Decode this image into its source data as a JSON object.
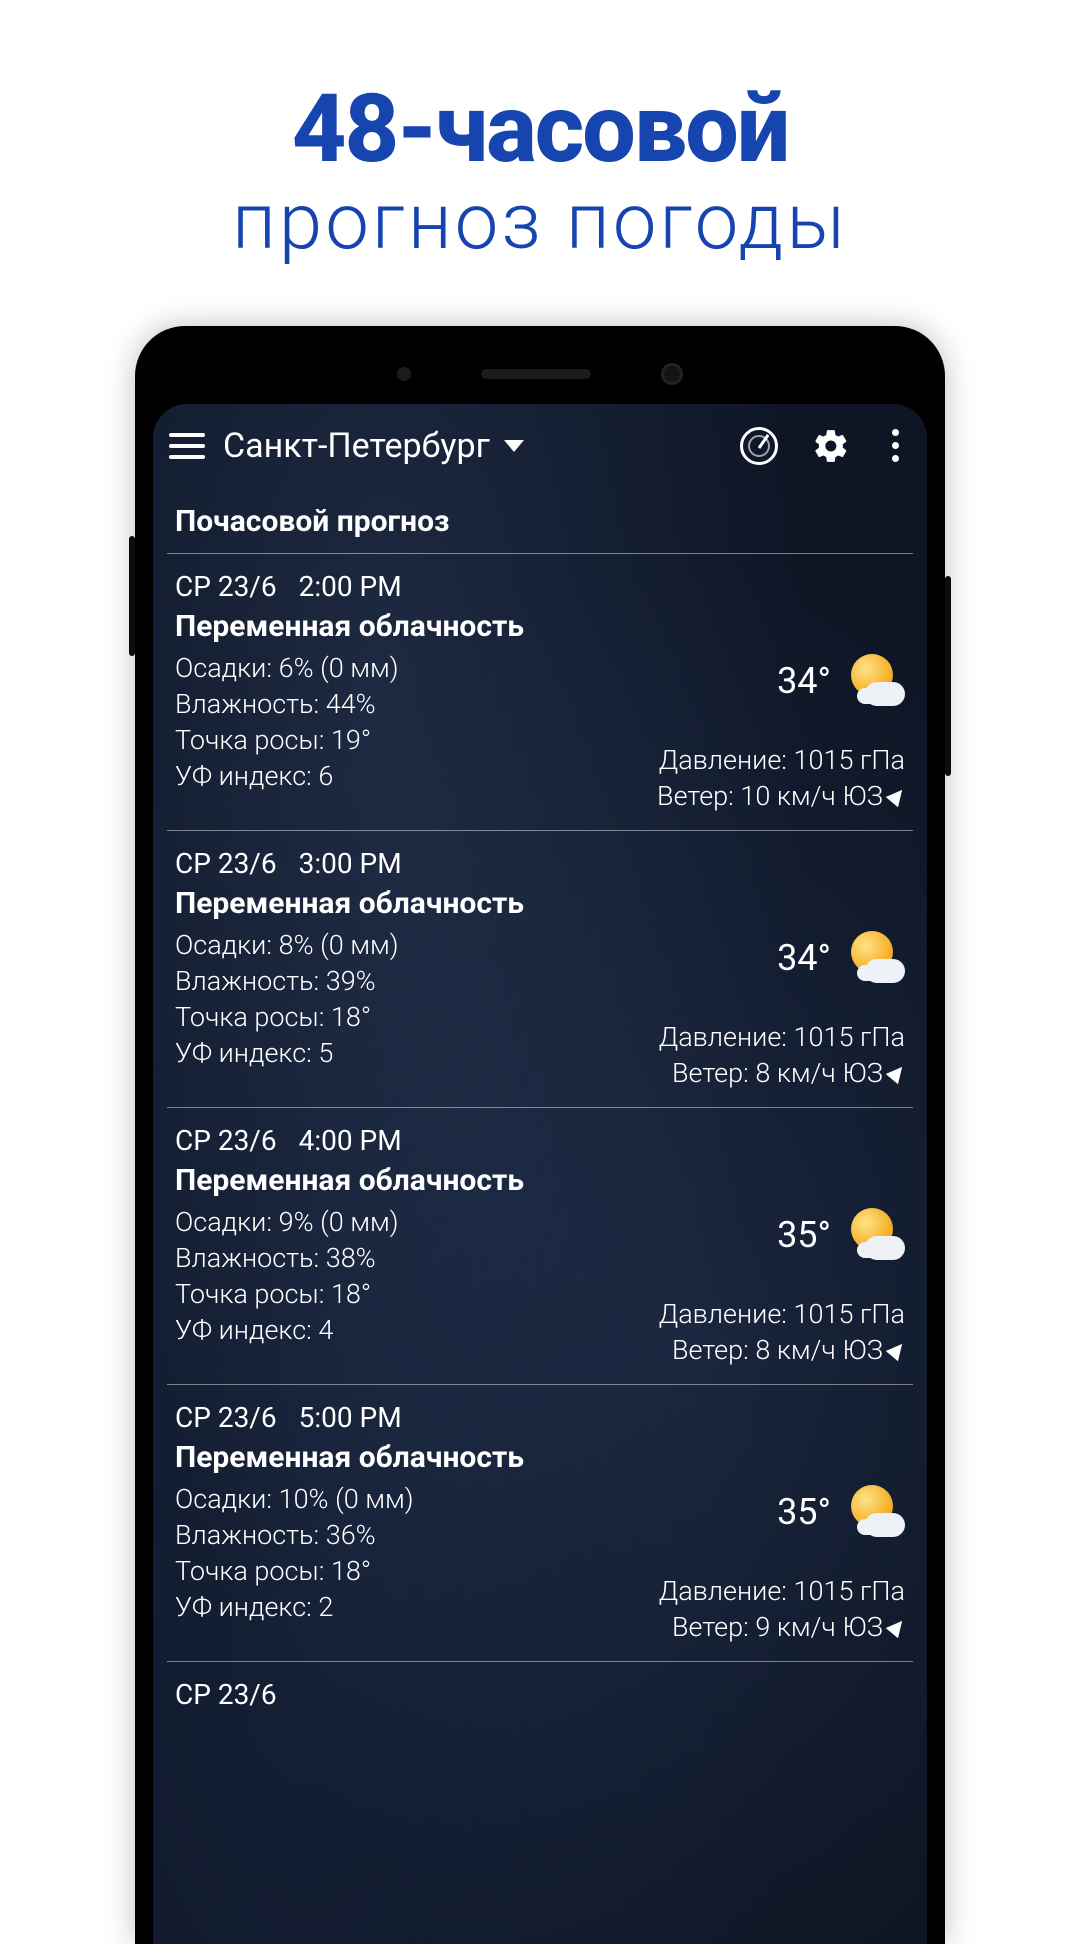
{
  "promo": {
    "title": "48-часовой",
    "subtitle": "прогноз погоды"
  },
  "appbar": {
    "location": "Санкт-Петербург"
  },
  "section_title": "Почасовой прогноз",
  "labels": {
    "precip": "Осадки:",
    "humidity": "Влажность:",
    "dewpoint": "Точка росы:",
    "uv": "УФ индекс:",
    "pressure": "Давление:",
    "wind": "Ветер:"
  },
  "hours": [
    {
      "day": "СР 23/6",
      "time": "2:00 PM",
      "cond": "Переменная облачность",
      "precip": "6% (0 мм)",
      "humidity": "44%",
      "dewpoint": "19°",
      "uv": "6",
      "temp": "34°",
      "pressure": "1015 гПа",
      "wind": "10 км/ч ЮЗ"
    },
    {
      "day": "СР 23/6",
      "time": "3:00 PM",
      "cond": "Переменная облачность",
      "precip": "8% (0 мм)",
      "humidity": "39%",
      "dewpoint": "18°",
      "uv": "5",
      "temp": "34°",
      "pressure": "1015 гПа",
      "wind": "8 км/ч ЮЗ"
    },
    {
      "day": "СР 23/6",
      "time": "4:00 PM",
      "cond": "Переменная облачность",
      "precip": "9% (0 мм)",
      "humidity": "38%",
      "dewpoint": "18°",
      "uv": "4",
      "temp": "35°",
      "pressure": "1015 гПа",
      "wind": "8 км/ч ЮЗ"
    },
    {
      "day": "СР 23/6",
      "time": "5:00 PM",
      "cond": "Переменная облачность",
      "precip": "10% (0 мм)",
      "humidity": "36%",
      "dewpoint": "18°",
      "uv": "2",
      "temp": "35°",
      "pressure": "1015 гПа",
      "wind": "9 км/ч ЮЗ"
    },
    {
      "day": "СР 23/6",
      "time": "",
      "cond": "",
      "precip": "",
      "humidity": "",
      "dewpoint": "",
      "uv": "",
      "temp": "",
      "pressure": "",
      "wind": ""
    }
  ]
}
